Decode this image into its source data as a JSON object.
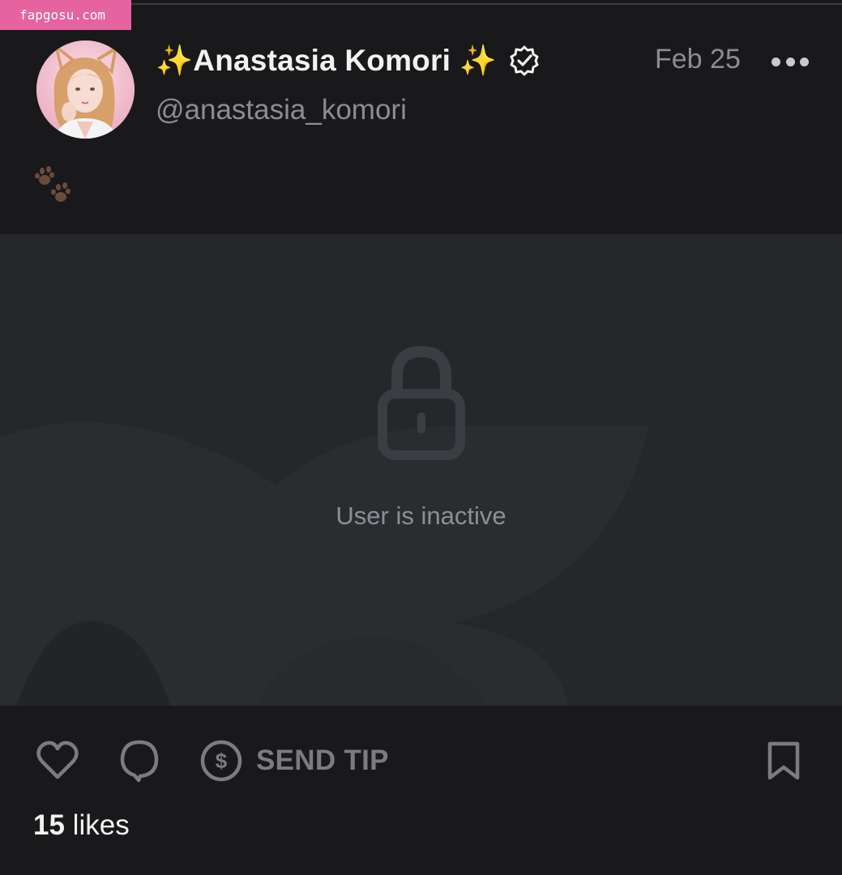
{
  "watermark": {
    "text": "fapgosu.com"
  },
  "post": {
    "author": {
      "display_name": "✨Anastasia Komori ✨",
      "username": "@anastasia_komori",
      "verified": true
    },
    "date": "Feb 25",
    "text": "🐾",
    "media": {
      "status_text": "User is inactive",
      "lock_icon": "lock-icon"
    },
    "actions": {
      "like_icon": "heart-icon",
      "comment_icon": "comment-bubble-icon",
      "tip_icon": "dollar-circle-icon",
      "tip_label": "SEND TIP",
      "bookmark_icon": "bookmark-icon",
      "more_icon": "more-dots-icon"
    },
    "likes": {
      "count": "15",
      "label": "likes"
    }
  },
  "colors": {
    "background": "#19191b",
    "media_background": "#25272a",
    "primary_text": "#f2f2f2",
    "secondary_text": "#8b8d93",
    "watermark": "#e5639f"
  }
}
